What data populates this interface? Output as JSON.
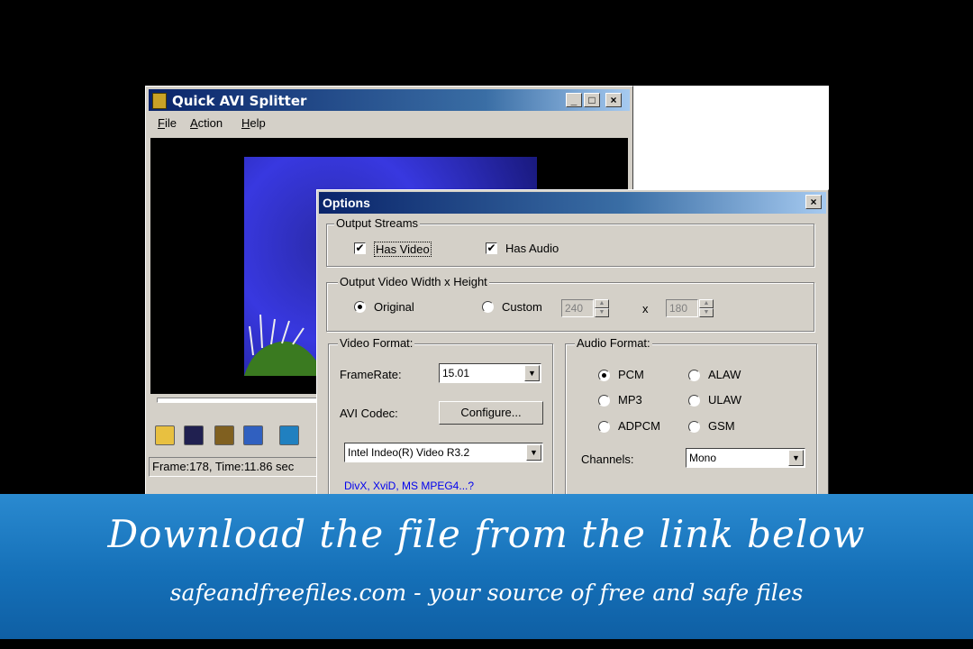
{
  "app": {
    "title": "Quick AVI Splitter",
    "menu": [
      "File",
      "Action",
      "Help"
    ],
    "window_buttons": [
      "_",
      "□",
      "×"
    ],
    "status": "Frame:178, Time:11.86 sec",
    "toolbar_icons": [
      "open-folder-icon",
      "save-icon",
      "cube-icon",
      "frame-icon",
      "export-icon"
    ]
  },
  "options": {
    "title": "Options",
    "close": "×",
    "output_streams": {
      "legend": "Output Streams",
      "has_video": "Has Video",
      "has_audio": "Has Audio",
      "check_mark": "✔"
    },
    "size": {
      "legend": "Output Video Width x Height",
      "original": "Original",
      "custom": "Custom",
      "width": "240",
      "times": "x",
      "height": "180"
    },
    "video": {
      "legend": "Video Format:",
      "framerate_label": "FrameRate:",
      "framerate_value": "15.01",
      "codec_label": "AVI Codec:",
      "configure": "Configure...",
      "codec_value": "Intel Indeo(R) Video R3.2",
      "link": "DivX, XviD, MS MPEG4...?"
    },
    "audio": {
      "legend": "Audio Format:",
      "pcm": "PCM",
      "alaw": "ALAW",
      "mp3": "MP3",
      "ulaw": "ULAW",
      "adpcm": "ADPCM",
      "gsm": "GSM",
      "channels_label": "Channels:",
      "channels_value": "Mono"
    },
    "dropdown_arrow": "▼"
  },
  "banner": {
    "headline": "Download the file from the link below",
    "sub": "safeandfreefiles.com - your source of free and safe files"
  },
  "colors": {
    "window_face": "#d4d0c8",
    "title_blue": "#0a246a",
    "banner_blue": "#1570b8"
  }
}
